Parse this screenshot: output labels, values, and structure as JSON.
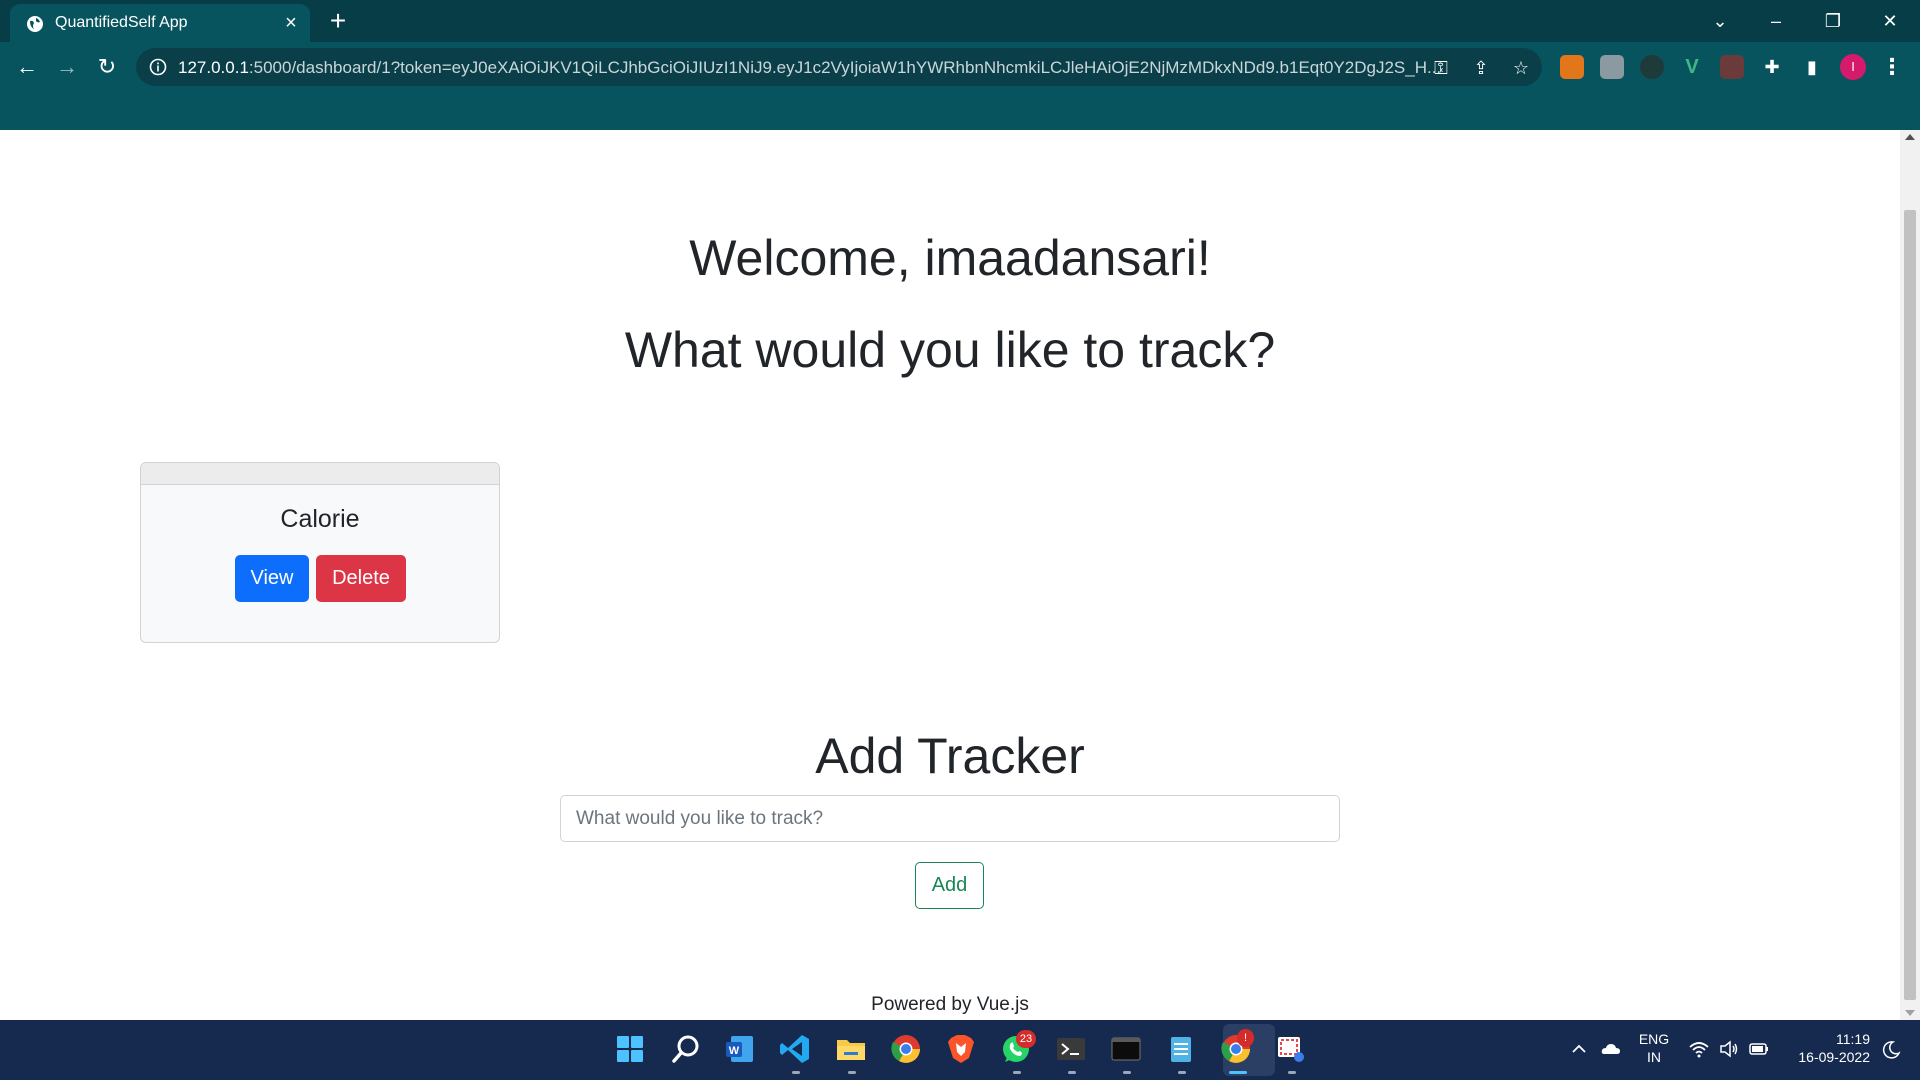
{
  "browser": {
    "tab_title": "QuantifiedSelf App",
    "url_host": "127.0.0.1",
    "url_rest": ":5000/dashboard/1?token=eyJ0eXAiOiJKV1QiLCJhbGciOiJIUzI1NiJ9.eyJ1c2VyIjoiaW1hYWRhbnNhcmkiLCJleHAiOjE2NjMzMDkxNDd9.b1Eqt0Y2DgJ2S_H...",
    "profile_initial": "I",
    "icons": {
      "new_tab": "+",
      "close": "×",
      "back": "←",
      "forward": "→",
      "reload": "↻",
      "minimize": "–",
      "restore": "❐",
      "window_close": "✕",
      "chevron": "⌄",
      "key": "⚿",
      "share": "⇪",
      "star": "☆",
      "puzzle": "✚",
      "sidepanel": "▮",
      "menu": "⋮"
    }
  },
  "main": {
    "welcome": "Welcome, imaadansari!",
    "question": "What would you like to track?",
    "trackers": [
      {
        "name": "Calorie",
        "view_label": "View",
        "delete_label": "Delete"
      }
    ],
    "add_section": {
      "title": "Add Tracker",
      "placeholder": "What would you like to track?",
      "button_label": "Add"
    },
    "footer": "Powered by Vue.js"
  },
  "taskbar": {
    "lang_top": "ENG",
    "lang_bottom": "IN",
    "time": "11:19",
    "date": "16-09-2022",
    "whatsapp_badge": "23",
    "chrome_badge": "!"
  },
  "colors": {
    "primary": "#0d6efd",
    "danger": "#dc3545",
    "success": "#198754",
    "chrome_bg": "#08545e"
  }
}
